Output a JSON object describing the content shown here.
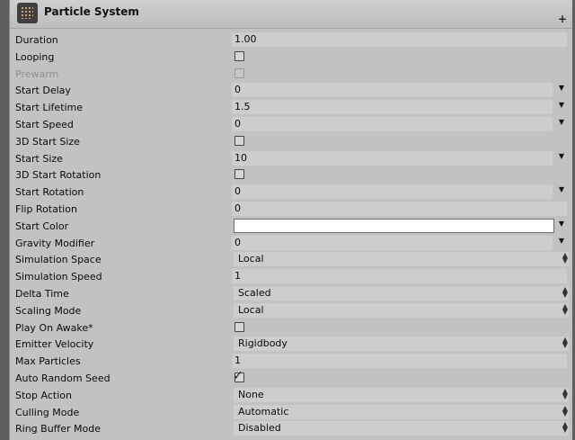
{
  "header": {
    "title": "Particle System"
  },
  "rows": [
    {
      "label": "Duration",
      "type": "text",
      "value": "1.00"
    },
    {
      "label": "Looping",
      "type": "checkbox",
      "checked": false
    },
    {
      "label": "Prewarm",
      "type": "checkbox",
      "checked": false,
      "disabled": true
    },
    {
      "label": "Start Delay",
      "type": "curve",
      "value": "0"
    },
    {
      "label": "Start Lifetime",
      "type": "curve",
      "value": "1.5"
    },
    {
      "label": "Start Speed",
      "type": "curve",
      "value": "0"
    },
    {
      "label": "3D Start Size",
      "type": "checkbox",
      "checked": false
    },
    {
      "label": "Start Size",
      "type": "curve",
      "value": "10"
    },
    {
      "label": "3D Start Rotation",
      "type": "checkbox",
      "checked": false
    },
    {
      "label": "Start Rotation",
      "type": "curve",
      "value": "0"
    },
    {
      "label": "Flip Rotation",
      "type": "text",
      "value": "0"
    },
    {
      "label": "Start Color",
      "type": "color",
      "color": "#ffffff"
    },
    {
      "label": "Gravity Modifier",
      "type": "curve",
      "value": "0"
    },
    {
      "label": "Simulation Space",
      "type": "dropdown",
      "value": "Local"
    },
    {
      "label": "Simulation Speed",
      "type": "text",
      "value": "1"
    },
    {
      "label": "Delta Time",
      "type": "dropdown",
      "value": "Scaled"
    },
    {
      "label": "Scaling Mode",
      "type": "dropdown",
      "value": "Local"
    },
    {
      "label": "Play On Awake*",
      "type": "checkbox",
      "checked": false
    },
    {
      "label": "Emitter Velocity",
      "type": "dropdown",
      "value": "Rigidbody"
    },
    {
      "label": "Max Particles",
      "type": "text",
      "value": "1"
    },
    {
      "label": "Auto Random Seed",
      "type": "checkbox",
      "checked": true
    },
    {
      "label": "Stop Action",
      "type": "dropdown",
      "value": "None"
    },
    {
      "label": "Culling Mode",
      "type": "dropdown",
      "value": "Automatic"
    },
    {
      "label": "Ring Buffer Mode",
      "type": "dropdown",
      "value": "Disabled"
    }
  ]
}
